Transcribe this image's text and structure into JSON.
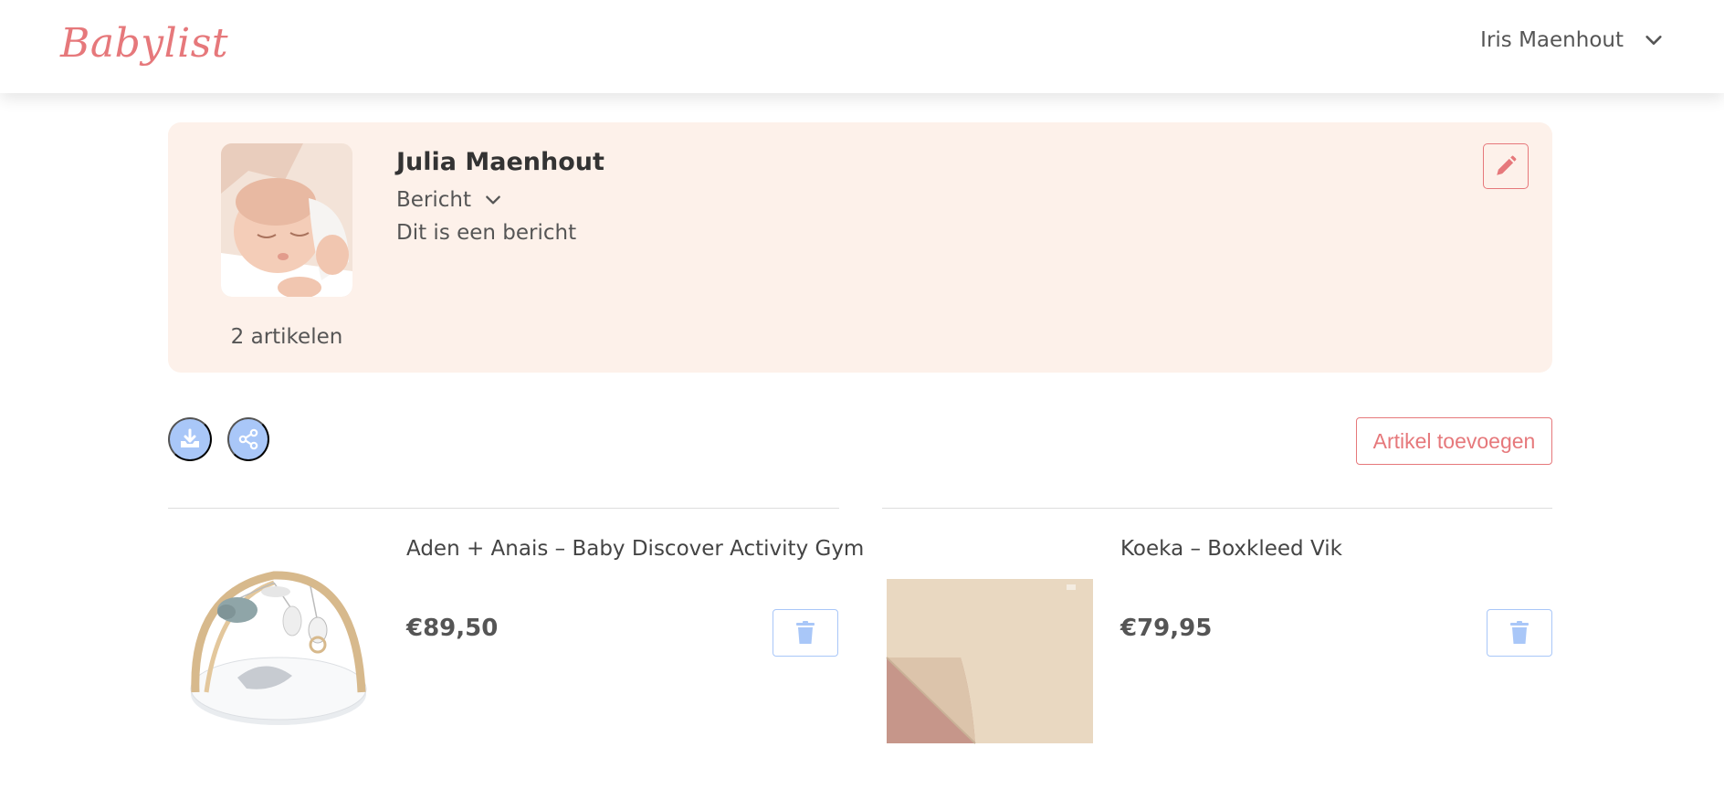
{
  "header": {
    "logo_text": "Babylist",
    "user_name": "Iris Maenhout",
    "user_menu_icon": "chevron-down-icon"
  },
  "profile": {
    "name": "Julia Maenhout",
    "message_label": "Bericht",
    "message_text": "Dit is een bericht",
    "article_count": "2 artikelen",
    "edit_icon": "pencil-icon"
  },
  "actions": {
    "download_icon": "download-icon",
    "share_icon": "share-icon",
    "add_article_label": "Artikel toevoegen"
  },
  "items": [
    {
      "title": "Aden + Anais – Baby Discover Activity Gym",
      "price": "€89,50",
      "delete_icon": "trash-icon"
    },
    {
      "title": "Koeka – Boxkleed Vik",
      "price": "€79,95",
      "delete_icon": "trash-icon"
    }
  ],
  "colors": {
    "brand_pink": "#e6787b",
    "card_bg": "#fdf1ea",
    "accent_blue": "#a9c7f8",
    "text": "#555555"
  }
}
